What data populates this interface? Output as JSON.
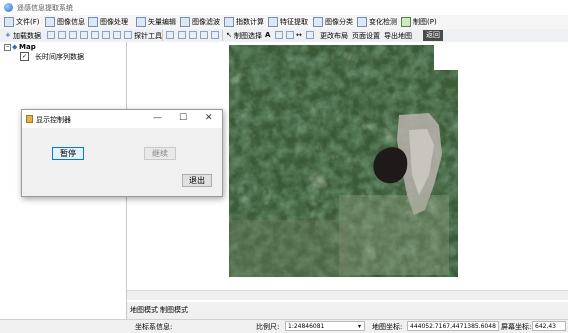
{
  "window": {
    "title": "遥感信息提取系统"
  },
  "menu": [
    {
      "label": "文件(F)"
    },
    {
      "label": "图像信息"
    },
    {
      "label": "图像处理"
    },
    {
      "label": "矢量编辑"
    },
    {
      "label": "图像滤波"
    },
    {
      "label": "指数计算"
    },
    {
      "label": "特征提取"
    },
    {
      "label": "图像分类"
    },
    {
      "label": "变化检测"
    },
    {
      "label": "制图(P)"
    }
  ],
  "toolbar": {
    "add_data": "加载数据",
    "explore": "探针工具",
    "map_select": "制图选择",
    "layout": "更改布局",
    "page_setup": "页面设置",
    "export": "导出地图",
    "dark_btn": "返回"
  },
  "layers": {
    "root": "Map",
    "collapse": "−",
    "items": [
      {
        "label": "长时间序列数据",
        "checked": "✓"
      }
    ]
  },
  "tabs": {
    "map_mode": "地图模式",
    "layout_mode": "制图模式"
  },
  "status": {
    "coord_sys_label": "坐标系信息:",
    "scale_label": "比例尺:",
    "scale_value": "1:24846081",
    "map_coord_label": "地图坐标:",
    "map_coord_value": "444052.7167,4471385.6048",
    "screen_coord_label": "屏幕坐标:",
    "screen_coord_value": "642,43"
  },
  "dialog": {
    "title": "显示控制器",
    "pause": "暂停",
    "resume": "继续",
    "exit": "退出",
    "min": "—",
    "max": "☐",
    "close": "✕"
  }
}
